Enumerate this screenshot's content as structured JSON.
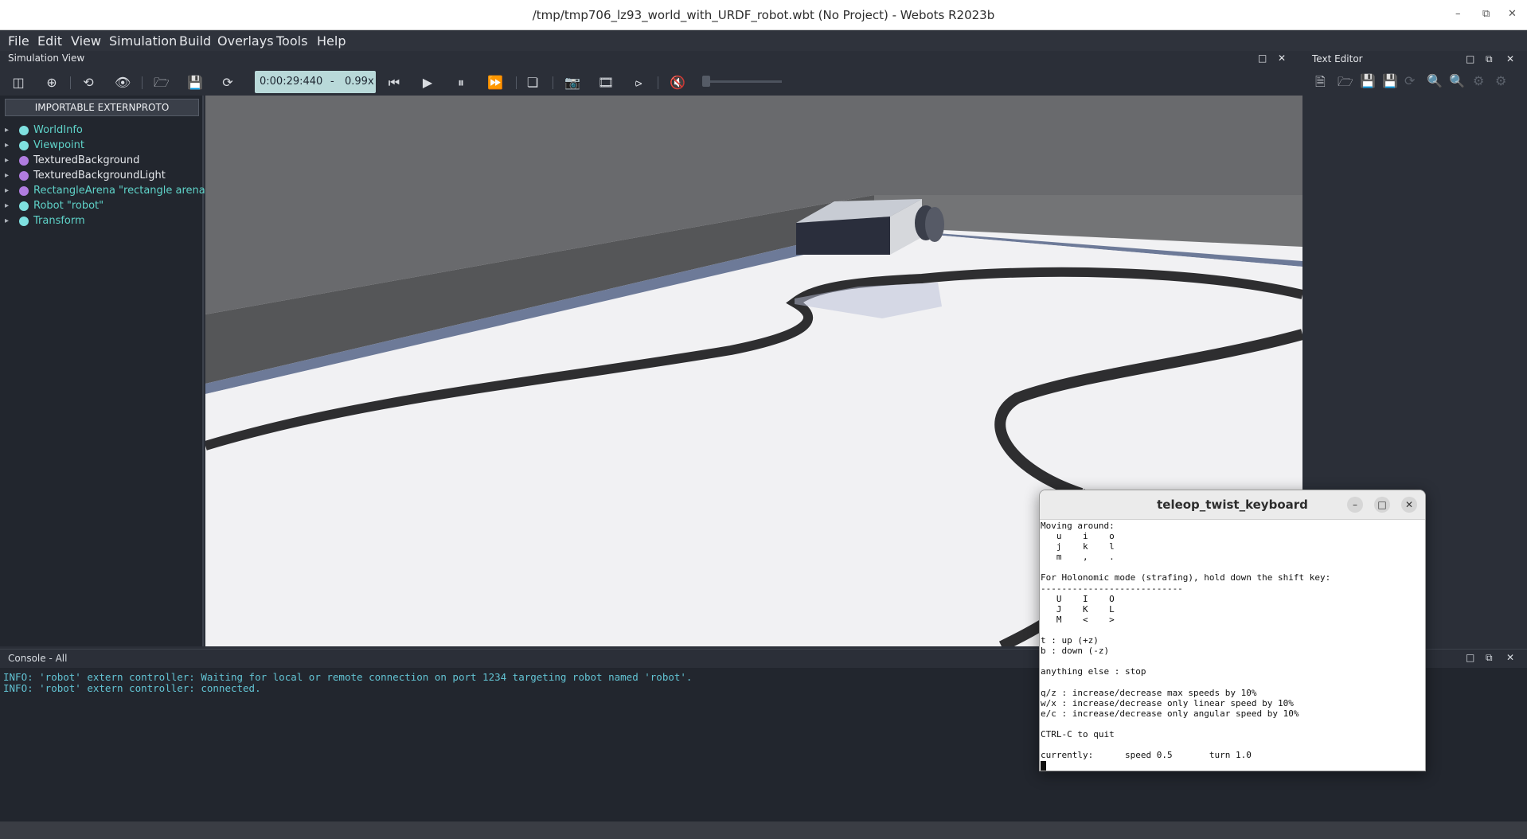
{
  "window": {
    "title": "/tmp/tmp706_lz93_world_with_URDF_robot.wbt (No Project) - Webots R2023b"
  },
  "menu": [
    "File",
    "Edit",
    "View",
    "Simulation",
    "Build",
    "Overlays",
    "Tools",
    "Help"
  ],
  "simulation_view": {
    "title": "Simulation View",
    "time": "0:00:29:440",
    "separator": "-",
    "speed": "0.99x"
  },
  "text_editor": {
    "title": "Text Editor"
  },
  "scene_tree": {
    "proto_button": "IMPORTABLE EXTERNPROTO",
    "items": [
      {
        "label": "WorldInfo",
        "color": "#5fd3c9",
        "dot": "#7fe0e0"
      },
      {
        "label": "Viewpoint",
        "color": "#5fd3c9",
        "dot": "#7fe0e0"
      },
      {
        "label": "TexturedBackground",
        "color": "#e6e8ec",
        "dot": "#b07ce0"
      },
      {
        "label": "TexturedBackgroundLight",
        "color": "#e6e8ec",
        "dot": "#b07ce0"
      },
      {
        "label": "RectangleArena \"rectangle arena\"",
        "color": "#5fd3c9",
        "dot": "#b07ce0"
      },
      {
        "label": "Robot \"robot\"",
        "color": "#5fd3c9",
        "dot": "#7fe0e0"
      },
      {
        "label": "Transform",
        "color": "#5fd3c9",
        "dot": "#7fe0e0"
      }
    ]
  },
  "console": {
    "title": "Console - All",
    "lines": [
      "INFO: 'robot' extern controller: Waiting for local or remote connection on port 1234 targeting robot named 'robot'.",
      "INFO: 'robot' extern controller: connected."
    ]
  },
  "terminal": {
    "title": "teleop_twist_keyboard",
    "lines": [
      "Moving around:",
      "   u    i    o",
      "   j    k    l",
      "   m    ,    .",
      "",
      "For Holonomic mode (strafing), hold down the shift key:",
      "---------------------------",
      "   U    I    O",
      "   J    K    L",
      "   M    <    >",
      "",
      "t : up (+z)",
      "b : down (-z)",
      "",
      "anything else : stop",
      "",
      "q/z : increase/decrease max speeds by 10%",
      "w/x : increase/decrease only linear speed by 10%",
      "e/c : increase/decrease only angular speed by 10%",
      "",
      "CTRL-C to quit",
      "",
      "currently:      speed 0.5       turn 1.0"
    ]
  }
}
